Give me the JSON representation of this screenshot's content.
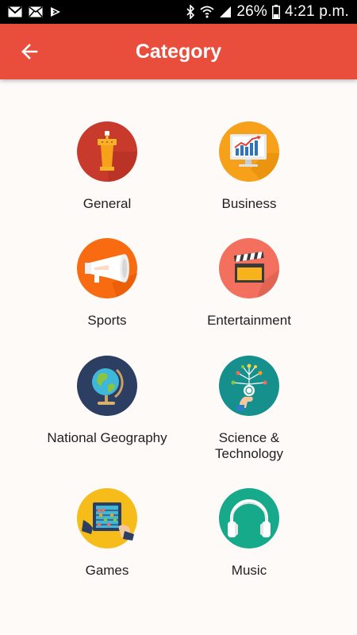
{
  "status_bar": {
    "battery": "26%",
    "time": "4:21 p.m.",
    "left_icons": [
      "gmail-icon",
      "mail-icon",
      "notification-icon"
    ],
    "right_icons": [
      "bluetooth-icon",
      "wifi-icon",
      "signal-icon",
      "battery-icon"
    ]
  },
  "app_bar": {
    "title": "Category",
    "back_icon": "back-arrow-icon",
    "color": "#e94e3d"
  },
  "categories": [
    {
      "label": "General",
      "icon": "podium-icon",
      "color": "#c83a2c"
    },
    {
      "label": "Business",
      "icon": "monitor-chart-icon",
      "color": "#f7a11b"
    },
    {
      "label": "Sports",
      "icon": "megaphone-icon",
      "color": "#f96b10"
    },
    {
      "label": "Entertainment",
      "icon": "clapperboard-icon",
      "color": "#f2705d"
    },
    {
      "label": "National Geography",
      "icon": "globe-icon",
      "color": "#2d3e63"
    },
    {
      "label": "Science &\nTechnology",
      "icon": "tech-network-icon",
      "color": "#16908c"
    },
    {
      "label": "Games",
      "icon": "abacus-icon",
      "color": "#f6bd1a"
    },
    {
      "label": "Music",
      "icon": "headphones-icon",
      "color": "#16a98a"
    }
  ]
}
